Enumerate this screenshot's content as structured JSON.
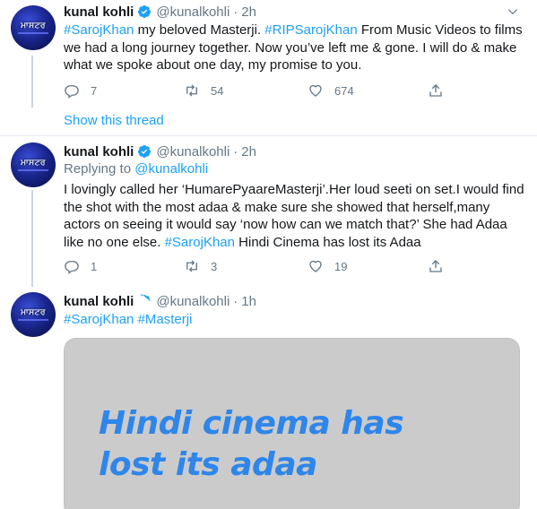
{
  "colors": {
    "link": "#1da1f2",
    "muted": "#657786",
    "text": "#14171a",
    "media_bg": "#cbcbcb",
    "media_text": "#2e86ea"
  },
  "avatar": {
    "text": "ਮਾਸਟਰ"
  },
  "tweets": [
    {
      "name": "kunal kohli",
      "handle": "@kunalkohli",
      "sep": "·",
      "time": "2h",
      "hashtag1": "#SarojKhan",
      "text1": " my beloved Masterji. ",
      "hashtag2": "#RIPSarojKhan",
      "text2": " From Music Videos to films we had a long journey together. Now you’ve left me & gone. I will do & make what we spoke about one day, my promise to you.",
      "replies": "7",
      "retweets": "54",
      "likes": "674"
    },
    {
      "name": "kunal kohli",
      "handle": "@kunalkohli",
      "sep": "·",
      "time": "2h",
      "replying_label": "Replying to ",
      "replying_handle": "@kunalkohli",
      "text1": "I lovingly called her ‘HumarePyaareMasterji’.Her loud seeti on set.I would find the shot with the most adaa & make sure she showed that herself,many actors on seeing it would say ‘now how can we match that?’ She had Adaa like no one else. ",
      "hashtag1": "#SarojKhan",
      "text2": " Hindi Cinema has lost its Adaa",
      "replies": "1",
      "retweets": "3",
      "likes": "19"
    },
    {
      "name": "kunal kohli",
      "handle": "@kunalkohli",
      "sep": "·",
      "time": "1h",
      "hashtag1": "#SarojKhan",
      "hashtag2": "#Masterji",
      "media_line1": "Hindi cinema has",
      "media_line2": "lost its adaa"
    }
  ],
  "show_thread": "Show this thread"
}
